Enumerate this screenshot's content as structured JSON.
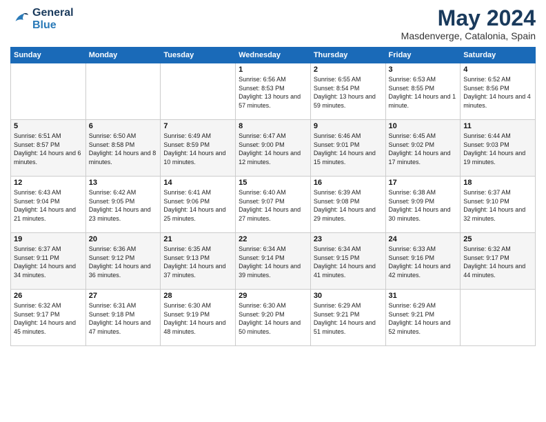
{
  "header": {
    "logo_line1": "General",
    "logo_line2": "Blue",
    "title": "May 2024",
    "subtitle": "Masdenverge, Catalonia, Spain"
  },
  "weekdays": [
    "Sunday",
    "Monday",
    "Tuesday",
    "Wednesday",
    "Thursday",
    "Friday",
    "Saturday"
  ],
  "weeks": [
    [
      {
        "day": "",
        "sunrise": "",
        "sunset": "",
        "daylight": ""
      },
      {
        "day": "",
        "sunrise": "",
        "sunset": "",
        "daylight": ""
      },
      {
        "day": "",
        "sunrise": "",
        "sunset": "",
        "daylight": ""
      },
      {
        "day": "1",
        "sunrise": "Sunrise: 6:56 AM",
        "sunset": "Sunset: 8:53 PM",
        "daylight": "Daylight: 13 hours and 57 minutes."
      },
      {
        "day": "2",
        "sunrise": "Sunrise: 6:55 AM",
        "sunset": "Sunset: 8:54 PM",
        "daylight": "Daylight: 13 hours and 59 minutes."
      },
      {
        "day": "3",
        "sunrise": "Sunrise: 6:53 AM",
        "sunset": "Sunset: 8:55 PM",
        "daylight": "Daylight: 14 hours and 1 minute."
      },
      {
        "day": "4",
        "sunrise": "Sunrise: 6:52 AM",
        "sunset": "Sunset: 8:56 PM",
        "daylight": "Daylight: 14 hours and 4 minutes."
      }
    ],
    [
      {
        "day": "5",
        "sunrise": "Sunrise: 6:51 AM",
        "sunset": "Sunset: 8:57 PM",
        "daylight": "Daylight: 14 hours and 6 minutes."
      },
      {
        "day": "6",
        "sunrise": "Sunrise: 6:50 AM",
        "sunset": "Sunset: 8:58 PM",
        "daylight": "Daylight: 14 hours and 8 minutes."
      },
      {
        "day": "7",
        "sunrise": "Sunrise: 6:49 AM",
        "sunset": "Sunset: 8:59 PM",
        "daylight": "Daylight: 14 hours and 10 minutes."
      },
      {
        "day": "8",
        "sunrise": "Sunrise: 6:47 AM",
        "sunset": "Sunset: 9:00 PM",
        "daylight": "Daylight: 14 hours and 12 minutes."
      },
      {
        "day": "9",
        "sunrise": "Sunrise: 6:46 AM",
        "sunset": "Sunset: 9:01 PM",
        "daylight": "Daylight: 14 hours and 15 minutes."
      },
      {
        "day": "10",
        "sunrise": "Sunrise: 6:45 AM",
        "sunset": "Sunset: 9:02 PM",
        "daylight": "Daylight: 14 hours and 17 minutes."
      },
      {
        "day": "11",
        "sunrise": "Sunrise: 6:44 AM",
        "sunset": "Sunset: 9:03 PM",
        "daylight": "Daylight: 14 hours and 19 minutes."
      }
    ],
    [
      {
        "day": "12",
        "sunrise": "Sunrise: 6:43 AM",
        "sunset": "Sunset: 9:04 PM",
        "daylight": "Daylight: 14 hours and 21 minutes."
      },
      {
        "day": "13",
        "sunrise": "Sunrise: 6:42 AM",
        "sunset": "Sunset: 9:05 PM",
        "daylight": "Daylight: 14 hours and 23 minutes."
      },
      {
        "day": "14",
        "sunrise": "Sunrise: 6:41 AM",
        "sunset": "Sunset: 9:06 PM",
        "daylight": "Daylight: 14 hours and 25 minutes."
      },
      {
        "day": "15",
        "sunrise": "Sunrise: 6:40 AM",
        "sunset": "Sunset: 9:07 PM",
        "daylight": "Daylight: 14 hours and 27 minutes."
      },
      {
        "day": "16",
        "sunrise": "Sunrise: 6:39 AM",
        "sunset": "Sunset: 9:08 PM",
        "daylight": "Daylight: 14 hours and 29 minutes."
      },
      {
        "day": "17",
        "sunrise": "Sunrise: 6:38 AM",
        "sunset": "Sunset: 9:09 PM",
        "daylight": "Daylight: 14 hours and 30 minutes."
      },
      {
        "day": "18",
        "sunrise": "Sunrise: 6:37 AM",
        "sunset": "Sunset: 9:10 PM",
        "daylight": "Daylight: 14 hours and 32 minutes."
      }
    ],
    [
      {
        "day": "19",
        "sunrise": "Sunrise: 6:37 AM",
        "sunset": "Sunset: 9:11 PM",
        "daylight": "Daylight: 14 hours and 34 minutes."
      },
      {
        "day": "20",
        "sunrise": "Sunrise: 6:36 AM",
        "sunset": "Sunset: 9:12 PM",
        "daylight": "Daylight: 14 hours and 36 minutes."
      },
      {
        "day": "21",
        "sunrise": "Sunrise: 6:35 AM",
        "sunset": "Sunset: 9:13 PM",
        "daylight": "Daylight: 14 hours and 37 minutes."
      },
      {
        "day": "22",
        "sunrise": "Sunrise: 6:34 AM",
        "sunset": "Sunset: 9:14 PM",
        "daylight": "Daylight: 14 hours and 39 minutes."
      },
      {
        "day": "23",
        "sunrise": "Sunrise: 6:34 AM",
        "sunset": "Sunset: 9:15 PM",
        "daylight": "Daylight: 14 hours and 41 minutes."
      },
      {
        "day": "24",
        "sunrise": "Sunrise: 6:33 AM",
        "sunset": "Sunset: 9:16 PM",
        "daylight": "Daylight: 14 hours and 42 minutes."
      },
      {
        "day": "25",
        "sunrise": "Sunrise: 6:32 AM",
        "sunset": "Sunset: 9:17 PM",
        "daylight": "Daylight: 14 hours and 44 minutes."
      }
    ],
    [
      {
        "day": "26",
        "sunrise": "Sunrise: 6:32 AM",
        "sunset": "Sunset: 9:17 PM",
        "daylight": "Daylight: 14 hours and 45 minutes."
      },
      {
        "day": "27",
        "sunrise": "Sunrise: 6:31 AM",
        "sunset": "Sunset: 9:18 PM",
        "daylight": "Daylight: 14 hours and 47 minutes."
      },
      {
        "day": "28",
        "sunrise": "Sunrise: 6:30 AM",
        "sunset": "Sunset: 9:19 PM",
        "daylight": "Daylight: 14 hours and 48 minutes."
      },
      {
        "day": "29",
        "sunrise": "Sunrise: 6:30 AM",
        "sunset": "Sunset: 9:20 PM",
        "daylight": "Daylight: 14 hours and 50 minutes."
      },
      {
        "day": "30",
        "sunrise": "Sunrise: 6:29 AM",
        "sunset": "Sunset: 9:21 PM",
        "daylight": "Daylight: 14 hours and 51 minutes."
      },
      {
        "day": "31",
        "sunrise": "Sunrise: 6:29 AM",
        "sunset": "Sunset: 9:21 PM",
        "daylight": "Daylight: 14 hours and 52 minutes."
      },
      {
        "day": "",
        "sunrise": "",
        "sunset": "",
        "daylight": ""
      }
    ]
  ]
}
